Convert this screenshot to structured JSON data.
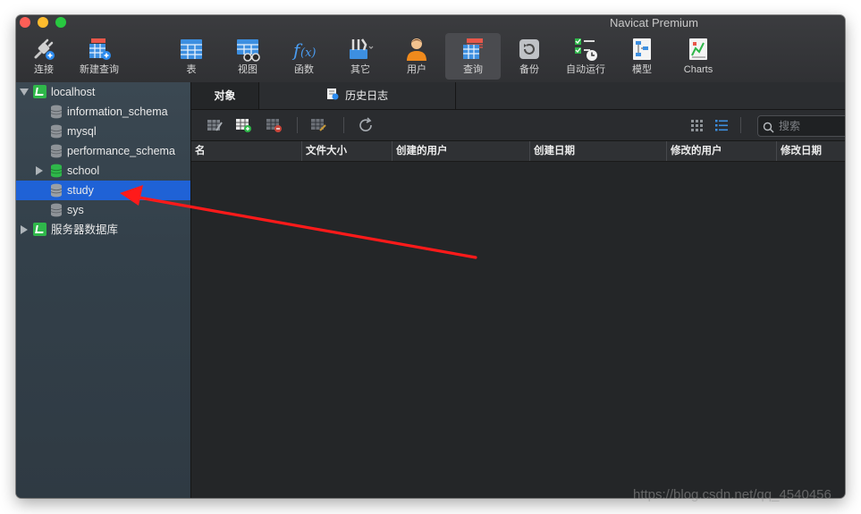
{
  "window": {
    "title": "Navicat Premium"
  },
  "toolbar": {
    "items": [
      {
        "label": "连接",
        "icon": "plug-icon"
      },
      {
        "label": "新建查询",
        "icon": "new-query-icon"
      },
      {
        "label": "表",
        "icon": "table-icon"
      },
      {
        "label": "视图",
        "icon": "view-icon"
      },
      {
        "label": "函数",
        "icon": "function-icon"
      },
      {
        "label": "其它",
        "icon": "tools-icon"
      },
      {
        "label": "用户",
        "icon": "user-icon"
      },
      {
        "label": "查询",
        "icon": "query-icon",
        "active": true
      },
      {
        "label": "备份",
        "icon": "backup-icon"
      },
      {
        "label": "自动运行",
        "icon": "automation-icon"
      },
      {
        "label": "模型",
        "icon": "model-icon"
      },
      {
        "label": "Charts",
        "icon": "charts-icon"
      }
    ]
  },
  "sidebar": {
    "connections": [
      {
        "name": "localhost",
        "expanded": true,
        "databases": [
          {
            "name": "information_schema",
            "active": false
          },
          {
            "name": "mysql",
            "active": false
          },
          {
            "name": "performance_schema",
            "active": false
          },
          {
            "name": "school",
            "active": true,
            "collapsed": true
          },
          {
            "name": "study",
            "active": false,
            "selected": true
          },
          {
            "name": "sys",
            "active": false
          }
        ]
      },
      {
        "name": "服务器数据库",
        "expanded": false,
        "databases": []
      }
    ]
  },
  "main": {
    "tabs": [
      {
        "label": "对象",
        "active": true
      },
      {
        "label": "历史日志",
        "active": false,
        "icon": "history-log-icon"
      }
    ],
    "search_placeholder": "搜索",
    "columns": [
      "名",
      "文件大小",
      "创建的用户",
      "创建日期",
      "修改的用户",
      "修改日期"
    ]
  },
  "colors": {
    "accent_selected": "#1f62d6",
    "db_active": "#2fb74a",
    "annotation_arrow": "#ff1a1a"
  },
  "watermark": "https://blog.csdn.net/qq_4540456"
}
